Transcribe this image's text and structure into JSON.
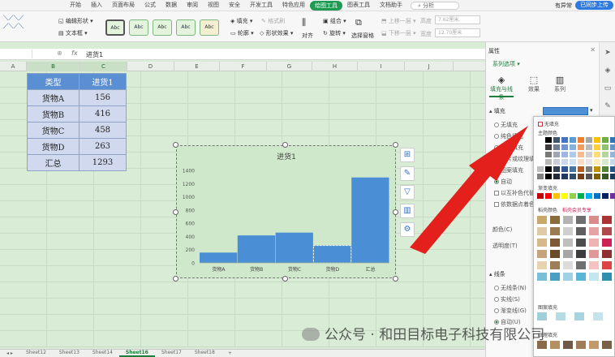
{
  "menubar": {
    "items": [
      "开始",
      "插入",
      "页面布局",
      "公式",
      "数据",
      "审阅",
      "视图",
      "安全",
      "开发工具",
      "特色应用",
      "绘图工具",
      "图表工具",
      "文档助手"
    ],
    "active_index": 10,
    "search_placeholder": "分析",
    "status": "有异常",
    "cloud_button": "已同步上传"
  },
  "ribbon": {
    "edit_shape": "编辑形状",
    "text_box": "文本框",
    "style_label": "Abc",
    "fill": "填充",
    "format_painter": "格式刷",
    "outline": "轮廓",
    "shape_effects": "形状效果",
    "align": "对齐",
    "group": "组合",
    "rotate": "旋转",
    "selection_pane": "选择窗格",
    "bring_forward": "上移一层",
    "send_backward": "下移一层",
    "height_label": "高度",
    "height_value": "7.62厘米",
    "width_label": "宽度",
    "width_value": "12.70厘米"
  },
  "formula_bar": {
    "fx": "fx",
    "value": "进货1"
  },
  "columns": [
    "A",
    "B",
    "C",
    "D",
    "E",
    "F",
    "G",
    "H",
    "I",
    "J"
  ],
  "table": {
    "header": [
      "类型",
      "进货1"
    ],
    "rows": [
      [
        "货物A",
        "156"
      ],
      [
        "货物B",
        "416"
      ],
      [
        "货物C",
        "458"
      ],
      [
        "货物D",
        "263"
      ],
      [
        "汇总",
        "1293"
      ]
    ]
  },
  "chart_data": {
    "type": "bar",
    "title": "进货1",
    "categories": [
      "货物A",
      "货物B",
      "货物C",
      "货物D",
      "汇总"
    ],
    "values": [
      156,
      416,
      458,
      263,
      1293
    ],
    "yticks": [
      0,
      200,
      400,
      600,
      800,
      1000,
      1200,
      1400
    ],
    "ylim": [
      0,
      1400
    ],
    "bar_color": "#4a8fd6",
    "gap_width": 0,
    "grid": false,
    "selected_category_index": 3
  },
  "sheet_tabs": [
    "Sheet12",
    "Sheet13",
    "Sheet14",
    "Sheet16",
    "Sheet17",
    "Sheet18"
  ],
  "active_sheet_index": 3,
  "pane": {
    "title": "属性",
    "series_options": "系列选项",
    "tabs": [
      "填充与线条",
      "效果",
      "系列"
    ],
    "fill_section": "填充",
    "fill_options": [
      "无填充",
      "纯色填充",
      "渐变填充",
      "图片或纹理填充",
      "图案填充",
      "自动"
    ],
    "checks": [
      "以互补色代替负值",
      "依数据点着色"
    ],
    "color_label": "颜色(C)",
    "transparency_label": "透明度(T)",
    "line_section": "线条",
    "line_options": [
      "无线条(N)",
      "实线(S)",
      "渐变线(G)",
      "自动(U)"
    ],
    "fill_color": "#4f8fd6"
  },
  "palette": {
    "no_fill": "无填充",
    "theme_colors": "主题颜色",
    "gradient_fill": "渐变填充",
    "premium_colors": "稻壳颜色",
    "premium_exclusive": "稻壳会员专享",
    "pattern_fill": "图案填充",
    "texture_fill": "纹理填充"
  },
  "watermark": "公众号 · 和田目标电子科技有限公司"
}
